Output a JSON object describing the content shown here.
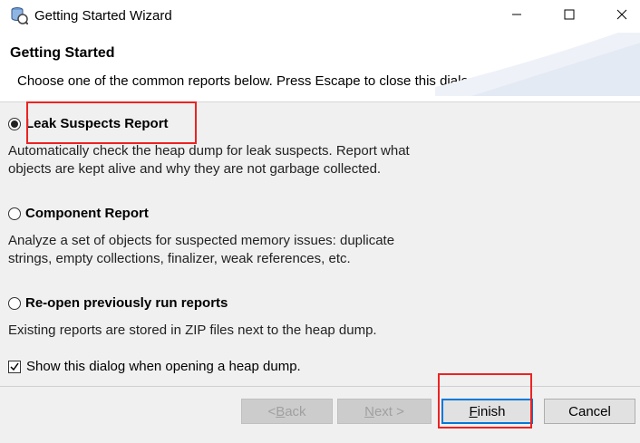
{
  "window": {
    "title": "Getting Started Wizard",
    "controls": {
      "minimize": "minimize-icon",
      "maximize": "maximize-icon",
      "close": "close-icon"
    }
  },
  "header": {
    "title": "Getting Started",
    "description": "Choose one of the common reports below. Press Escape to close this dialog."
  },
  "options": [
    {
      "label": "Leak Suspects Report",
      "selected": true,
      "description": "Automatically check the heap dump for leak suspects. Report what objects are kept alive and why they are not garbage collected."
    },
    {
      "label": "Component Report",
      "selected": false,
      "description": "Analyze a set of objects for suspected memory issues: duplicate strings, empty collections, finalizer, weak references, etc."
    },
    {
      "label": "Re-open previously run reports",
      "selected": false,
      "description": "Existing reports are stored in ZIP files next to the heap dump."
    }
  ],
  "show_dialog_checkbox": {
    "label": "Show this dialog when opening a heap dump.",
    "checked": true
  },
  "buttons": {
    "back": {
      "pre": "< ",
      "mnemonic": "B",
      "post": "ack",
      "enabled": false
    },
    "next": {
      "mnemonic": "N",
      "post": "ext >",
      "enabled": false
    },
    "finish": {
      "mnemonic": "F",
      "post": "inish",
      "enabled": true
    },
    "cancel": {
      "label": "Cancel",
      "enabled": true
    }
  },
  "colors": {
    "highlight": "#ee2222",
    "default_button_border": "#0078d7"
  }
}
